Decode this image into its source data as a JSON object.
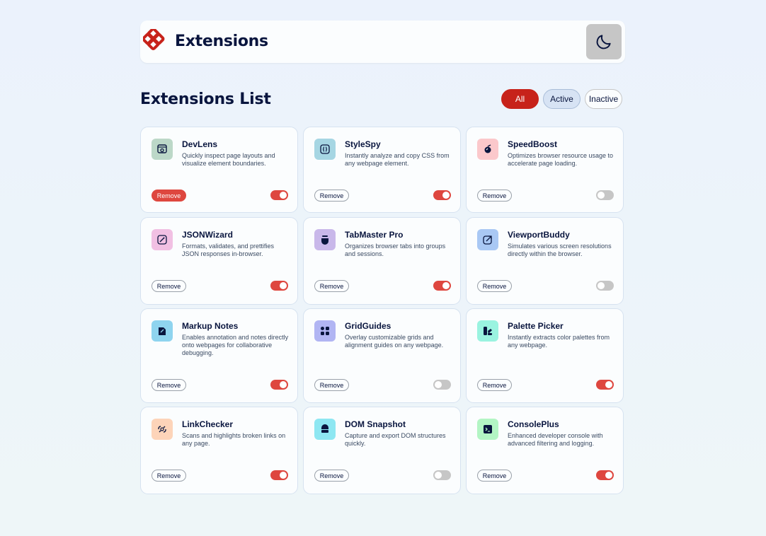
{
  "header": {
    "brand": "Extensions",
    "brand_color": "#c7221a",
    "logo_icon": "interlocking-diamonds-logo",
    "theme_toggle_icon": "moon-icon"
  },
  "list_title": "Extensions List",
  "filters": {
    "all": "All",
    "active": "Active",
    "inactive": "Inactive",
    "selected": "All"
  },
  "remove_label": "Remove",
  "colors": {
    "accent_red": "#de473f",
    "toggle_off": "#c6c6c6",
    "text_dark": "#09153e"
  },
  "extensions": [
    {
      "name": "DevLens",
      "description": "Quickly inspect page layouts and visualize element boundaries.",
      "active": true,
      "icon": "inspect-icon",
      "icon_bg": "#bcd8c8"
    },
    {
      "name": "StyleSpy",
      "description": "Instantly analyze and copy CSS from any webpage element.",
      "active": true,
      "icon": "css-braces-icon",
      "icon_bg": "#a6d6e3"
    },
    {
      "name": "SpeedBoost",
      "description": "Optimizes browser resource usage to accelerate page loading.",
      "active": false,
      "icon": "rocket-icon",
      "icon_bg": "#fbc8cb"
    },
    {
      "name": "JSONWizard",
      "description": "Formats, validates, and prettifies JSON responses in-browser.",
      "active": true,
      "icon": "wand-icon",
      "icon_bg": "#f1c0e3"
    },
    {
      "name": "TabMaster Pro",
      "description": "Organizes browser tabs into groups and sessions.",
      "active": true,
      "icon": "tabs-pot-icon",
      "icon_bg": "#c9b8ea"
    },
    {
      "name": "ViewportBuddy",
      "description": "Simulates various screen resolutions directly within the browser.",
      "active": false,
      "icon": "viewport-arrow-icon",
      "icon_bg": "#a9c8f4"
    },
    {
      "name": "Markup Notes",
      "description": "Enables annotation and notes directly onto webpages for collaborative debugging.",
      "active": true,
      "icon": "note-pencil-icon",
      "icon_bg": "#8fd4ef"
    },
    {
      "name": "GridGuides",
      "description": "Overlay customizable grids and alignment guides on any webpage.",
      "active": false,
      "icon": "grid-dots-icon",
      "icon_bg": "#b1b5f3"
    },
    {
      "name": "Palette Picker",
      "description": "Instantly extracts color palettes from any webpage.",
      "active": true,
      "icon": "palette-icon",
      "icon_bg": "#9af3e0"
    },
    {
      "name": "LinkChecker",
      "description": "Scans and highlights broken links on any page.",
      "active": true,
      "icon": "broken-link-icon",
      "icon_bg": "#fdd4b9"
    },
    {
      "name": "DOM Snapshot",
      "description": "Capture and export DOM structures quickly.",
      "active": false,
      "icon": "snapshot-icon",
      "icon_bg": "#8ee7f2"
    },
    {
      "name": "ConsolePlus",
      "description": "Enhanced developer console with advanced filtering and logging.",
      "active": true,
      "icon": "terminal-icon",
      "icon_bg": "#b3f5c4"
    }
  ]
}
